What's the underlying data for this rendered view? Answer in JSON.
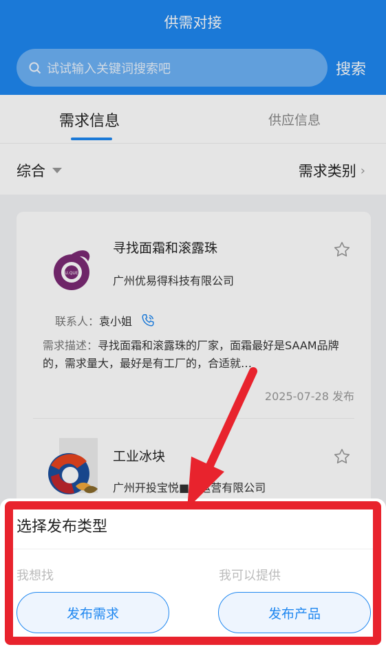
{
  "header": {
    "title": "供需对接"
  },
  "search": {
    "placeholder": "试试输入关键词搜索吧",
    "button_label": "搜索"
  },
  "tabs": [
    {
      "label": "需求信息",
      "active": true
    },
    {
      "label": "供应信息",
      "active": false
    }
  ],
  "filters": {
    "sort_label": "综合",
    "category_label": "需求类别"
  },
  "items": [
    {
      "title": "寻找面霜和滚露珠",
      "company": "广州优易得科技有限公司",
      "contact_label": "联系人：",
      "contact_name": "袁小姐",
      "desc_label": "需求描述：",
      "desc_text": "寻找面霜和滚露珠的厂家，面霜最好是SAAM品牌的，需求量大，最好是有工厂的，合适就…",
      "date": "2025-07-28 发布",
      "logo_text": "U.QUE"
    },
    {
      "title": "工业冰块",
      "company": "广州开投宝悦■■运营有限公司"
    }
  ],
  "sheet": {
    "title": "选择发布类型",
    "left_label": "我想找",
    "right_label": "我可以提供",
    "publish_demand": "发布需求",
    "publish_product": "发布产品"
  },
  "colors": {
    "primary": "#1f87f0",
    "annotation": "#e8232d"
  }
}
